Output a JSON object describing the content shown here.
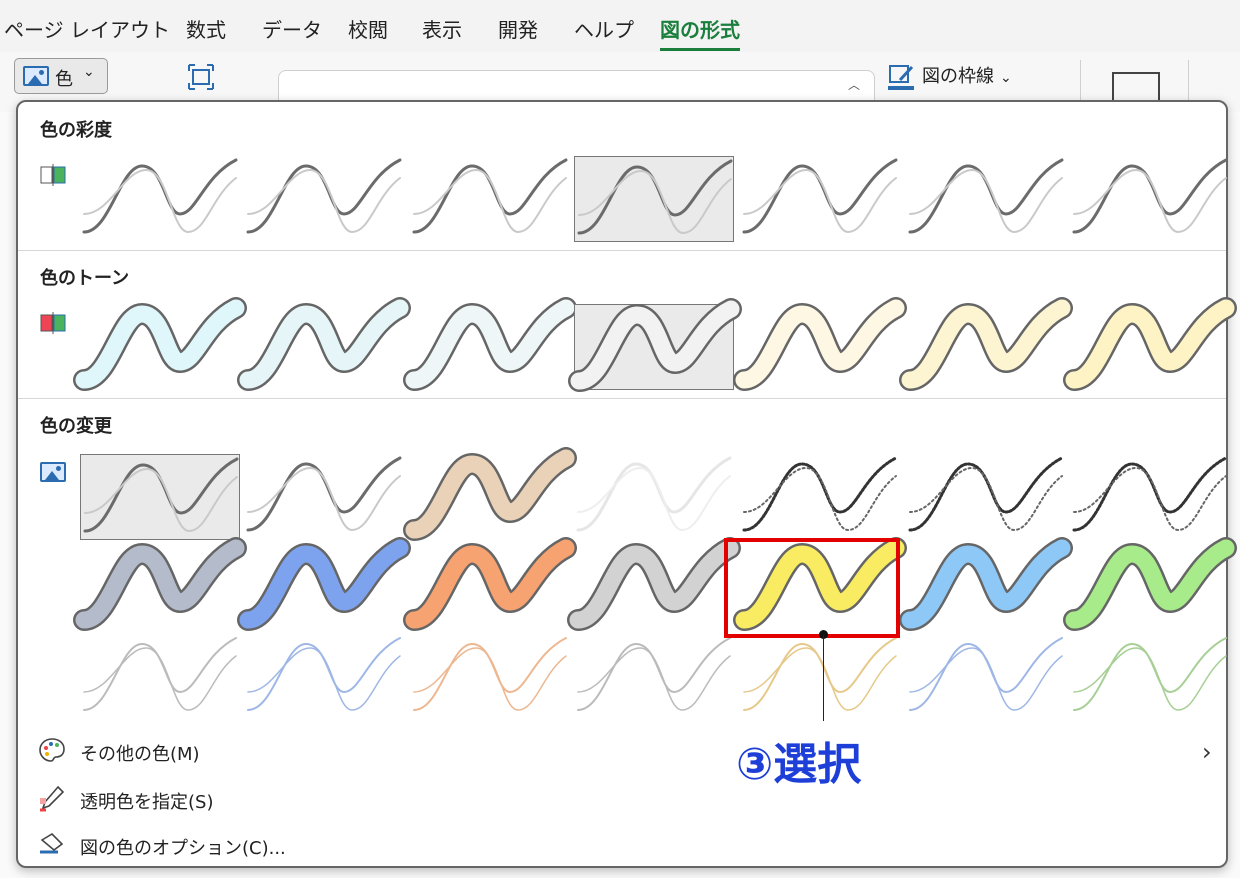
{
  "ribbon": {
    "tabs": [
      {
        "label": "ページ レイアウト",
        "active": false
      },
      {
        "label": "数式",
        "active": false
      },
      {
        "label": "データ",
        "active": false
      },
      {
        "label": "校閲",
        "active": false
      },
      {
        "label": "表示",
        "active": false
      },
      {
        "label": "開発",
        "active": false
      },
      {
        "label": "ヘルプ",
        "active": false
      },
      {
        "label": "図の形式",
        "active": true
      }
    ],
    "color_button": {
      "label": "色",
      "icon": "picture-icon"
    },
    "border_button": {
      "label": "図の枠線",
      "icon": "pen-icon"
    }
  },
  "color_panel": {
    "sections": [
      {
        "title": "色の彩度",
        "icon": "saturation-icon",
        "selected_index": 3,
        "swatches": [
          "none",
          "none",
          "none",
          "none",
          "none",
          "none",
          "none"
        ]
      },
      {
        "title": "色のトーン",
        "icon": "tone-icon",
        "selected_index": 3,
        "swatches": [
          "#dff6fb",
          "#e6f5f8",
          "#eef6f7",
          "#f2f2f2",
          "#fdf7e3",
          "#fdf4d2",
          "#fdf3c4"
        ]
      },
      {
        "title": "色の変更",
        "icon": "picture-icon",
        "selected_index": 0,
        "rows": [
          [
            "none",
            "none",
            "#e9d2b8",
            "washout",
            "dotted",
            "dotted",
            "dotted"
          ],
          [
            "#b4bccb",
            "#7ea3ee",
            "#f6a271",
            "#d2d2d2",
            "#f9ec62",
            "#8ec8f7",
            "#a7eb8a"
          ],
          [
            "light-gray",
            "light-blue",
            "light-orange",
            "light-gray",
            "light-gold",
            "light-blue",
            "light-green"
          ]
        ]
      }
    ],
    "menu": [
      {
        "label": "その他の色(M)",
        "icon": "palette-icon",
        "has_submenu": true
      },
      {
        "label": "透明色を指定(S)",
        "icon": "eyedropper-icon",
        "has_submenu": false
      },
      {
        "label": "図の色のオプション(C)...",
        "icon": "recolor-options-icon",
        "has_submenu": false
      }
    ]
  },
  "annotation": {
    "text": "③選択",
    "color": "#1d3fd8",
    "box_color": "#e20000"
  }
}
